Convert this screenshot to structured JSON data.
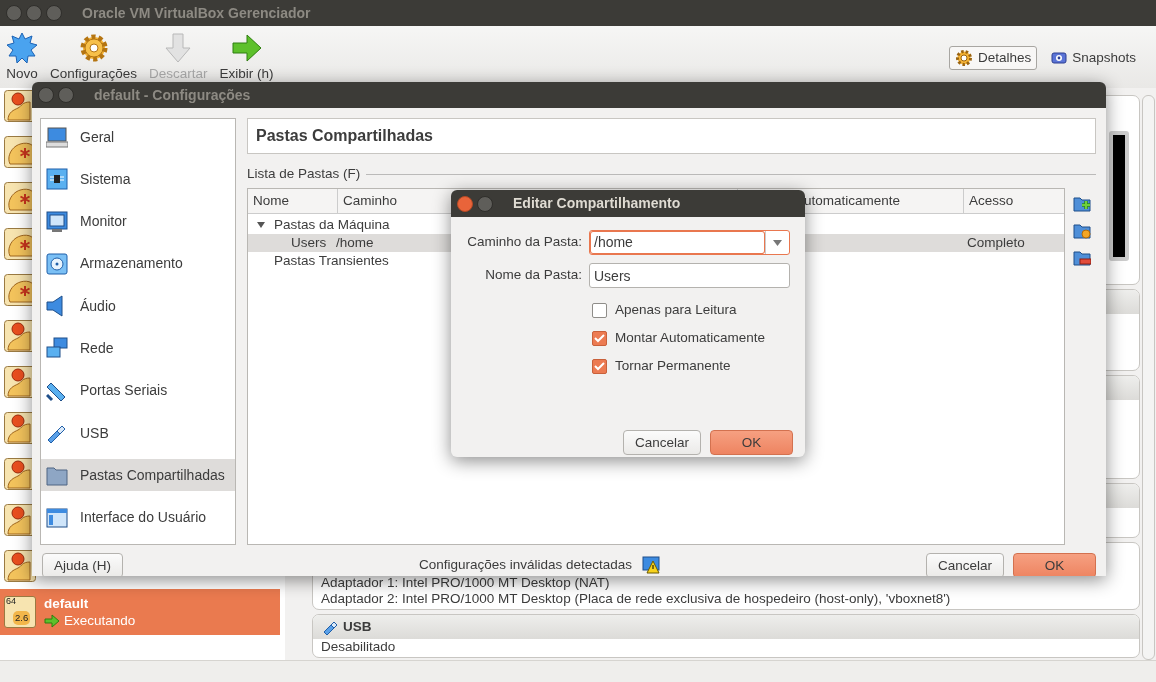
{
  "main_window": {
    "title": "Oracle VM VirtualBox Gerenciador"
  },
  "toolbar": [
    {
      "label": "Novo",
      "kind": "new",
      "disabled": false
    },
    {
      "label": "Configurações",
      "kind": "settings",
      "disabled": false
    },
    {
      "label": "Descartar",
      "kind": "discard",
      "disabled": true
    },
    {
      "label": "Exibir (h)",
      "kind": "show",
      "disabled": false
    }
  ],
  "view_tabs": [
    {
      "label": "Detalhes",
      "kind": "details",
      "selected": true
    },
    {
      "label": "Snapshots",
      "kind": "snapshots",
      "selected": false
    }
  ],
  "vm_list": [
    {
      "kind": "off",
      "selected": false
    },
    {
      "kind": "saved",
      "selected": false
    },
    {
      "kind": "saved",
      "selected": false
    },
    {
      "kind": "saved",
      "selected": false
    },
    {
      "kind": "saved",
      "selected": false
    },
    {
      "kind": "off",
      "selected": false
    },
    {
      "kind": "off",
      "selected": false
    },
    {
      "kind": "off",
      "selected": false
    },
    {
      "kind": "off",
      "selected": false
    },
    {
      "kind": "off",
      "selected": false
    },
    {
      "kind": "off",
      "selected": false
    },
    {
      "kind": "running",
      "name": "default",
      "status": "Executando",
      "os_badge": "64",
      "version": "2.6",
      "selected": true
    }
  ],
  "details": {
    "sections": [
      {
        "lines": [
          "Adaptador 1:   Intel PRO/1000 MT Desktop (NAT)",
          "Adaptador 2:   Intel PRO/1000 MT Desktop (Placa de rede exclusiva de hospedeiro (host-only), 'vboxnet8')"
        ]
      },
      {
        "title": "USB",
        "lines": [
          "Desabilitado"
        ]
      }
    ]
  },
  "settings_dialog": {
    "title": "default - Configurações",
    "nav": [
      {
        "label": "Geral",
        "kind": "general",
        "selected": false
      },
      {
        "label": "Sistema",
        "kind": "system",
        "selected": false
      },
      {
        "label": "Monitor",
        "kind": "display",
        "selected": false
      },
      {
        "label": "Armazenamento",
        "kind": "storage",
        "selected": false
      },
      {
        "label": "Áudio",
        "kind": "audio",
        "selected": false
      },
      {
        "label": "Rede",
        "kind": "network",
        "selected": false
      },
      {
        "label": "Portas Seriais",
        "kind": "serial",
        "selected": false
      },
      {
        "label": "USB",
        "kind": "usb",
        "selected": false
      },
      {
        "label": "Pastas Compartilhadas",
        "kind": "folder",
        "selected": true
      },
      {
        "label": "Interface do Usuário",
        "kind": "ui",
        "selected": false
      }
    ],
    "page_title": "Pastas Compartilhadas",
    "list_label": "Lista de Pastas (F)",
    "table": {
      "columns": [
        "Nome",
        "Caminho",
        "utomaticamente",
        "Acesso"
      ],
      "rows": [
        {
          "name": "Pastas da Máquina",
          "expanded": true,
          "children": [
            {
              "name": "Users",
              "path": "/home",
              "access": "Completo",
              "selected": true
            }
          ]
        },
        {
          "name": "Pastas Transientes",
          "children": []
        }
      ]
    },
    "warning": "Configurações inválidas detectadas",
    "buttons": {
      "help": "Ajuda (H)",
      "cancel": "Cancelar",
      "ok": "OK"
    }
  },
  "edit_dialog": {
    "title": "Editar Compartilhamento",
    "path_label": "Caminho da Pasta:",
    "path_value": "/home",
    "path_focused": true,
    "name_label": "Nome da Pasta:",
    "name_value": "Users",
    "options": [
      {
        "label": "Apenas para Leitura",
        "checked": false
      },
      {
        "label": "Montar Automaticamente",
        "checked": true
      },
      {
        "label": "Tornar Permanente",
        "checked": true
      }
    ],
    "buttons": {
      "cancel": "Cancelar",
      "ok": "OK"
    }
  }
}
